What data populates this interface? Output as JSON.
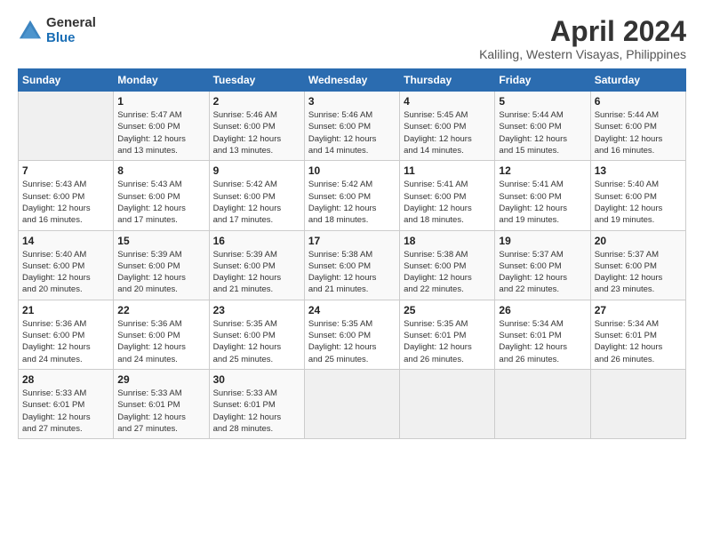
{
  "logo": {
    "general": "General",
    "blue": "Blue"
  },
  "title": "April 2024",
  "subtitle": "Kaliling, Western Visayas, Philippines",
  "days_header": [
    "Sunday",
    "Monday",
    "Tuesday",
    "Wednesday",
    "Thursday",
    "Friday",
    "Saturday"
  ],
  "weeks": [
    [
      {
        "num": "",
        "info": ""
      },
      {
        "num": "1",
        "info": "Sunrise: 5:47 AM\nSunset: 6:00 PM\nDaylight: 12 hours\nand 13 minutes."
      },
      {
        "num": "2",
        "info": "Sunrise: 5:46 AM\nSunset: 6:00 PM\nDaylight: 12 hours\nand 13 minutes."
      },
      {
        "num": "3",
        "info": "Sunrise: 5:46 AM\nSunset: 6:00 PM\nDaylight: 12 hours\nand 14 minutes."
      },
      {
        "num": "4",
        "info": "Sunrise: 5:45 AM\nSunset: 6:00 PM\nDaylight: 12 hours\nand 14 minutes."
      },
      {
        "num": "5",
        "info": "Sunrise: 5:44 AM\nSunset: 6:00 PM\nDaylight: 12 hours\nand 15 minutes."
      },
      {
        "num": "6",
        "info": "Sunrise: 5:44 AM\nSunset: 6:00 PM\nDaylight: 12 hours\nand 16 minutes."
      }
    ],
    [
      {
        "num": "7",
        "info": "Sunrise: 5:43 AM\nSunset: 6:00 PM\nDaylight: 12 hours\nand 16 minutes."
      },
      {
        "num": "8",
        "info": "Sunrise: 5:43 AM\nSunset: 6:00 PM\nDaylight: 12 hours\nand 17 minutes."
      },
      {
        "num": "9",
        "info": "Sunrise: 5:42 AM\nSunset: 6:00 PM\nDaylight: 12 hours\nand 17 minutes."
      },
      {
        "num": "10",
        "info": "Sunrise: 5:42 AM\nSunset: 6:00 PM\nDaylight: 12 hours\nand 18 minutes."
      },
      {
        "num": "11",
        "info": "Sunrise: 5:41 AM\nSunset: 6:00 PM\nDaylight: 12 hours\nand 18 minutes."
      },
      {
        "num": "12",
        "info": "Sunrise: 5:41 AM\nSunset: 6:00 PM\nDaylight: 12 hours\nand 19 minutes."
      },
      {
        "num": "13",
        "info": "Sunrise: 5:40 AM\nSunset: 6:00 PM\nDaylight: 12 hours\nand 19 minutes."
      }
    ],
    [
      {
        "num": "14",
        "info": "Sunrise: 5:40 AM\nSunset: 6:00 PM\nDaylight: 12 hours\nand 20 minutes."
      },
      {
        "num": "15",
        "info": "Sunrise: 5:39 AM\nSunset: 6:00 PM\nDaylight: 12 hours\nand 20 minutes."
      },
      {
        "num": "16",
        "info": "Sunrise: 5:39 AM\nSunset: 6:00 PM\nDaylight: 12 hours\nand 21 minutes."
      },
      {
        "num": "17",
        "info": "Sunrise: 5:38 AM\nSunset: 6:00 PM\nDaylight: 12 hours\nand 21 minutes."
      },
      {
        "num": "18",
        "info": "Sunrise: 5:38 AM\nSunset: 6:00 PM\nDaylight: 12 hours\nand 22 minutes."
      },
      {
        "num": "19",
        "info": "Sunrise: 5:37 AM\nSunset: 6:00 PM\nDaylight: 12 hours\nand 22 minutes."
      },
      {
        "num": "20",
        "info": "Sunrise: 5:37 AM\nSunset: 6:00 PM\nDaylight: 12 hours\nand 23 minutes."
      }
    ],
    [
      {
        "num": "21",
        "info": "Sunrise: 5:36 AM\nSunset: 6:00 PM\nDaylight: 12 hours\nand 24 minutes."
      },
      {
        "num": "22",
        "info": "Sunrise: 5:36 AM\nSunset: 6:00 PM\nDaylight: 12 hours\nand 24 minutes."
      },
      {
        "num": "23",
        "info": "Sunrise: 5:35 AM\nSunset: 6:00 PM\nDaylight: 12 hours\nand 25 minutes."
      },
      {
        "num": "24",
        "info": "Sunrise: 5:35 AM\nSunset: 6:00 PM\nDaylight: 12 hours\nand 25 minutes."
      },
      {
        "num": "25",
        "info": "Sunrise: 5:35 AM\nSunset: 6:01 PM\nDaylight: 12 hours\nand 26 minutes."
      },
      {
        "num": "26",
        "info": "Sunrise: 5:34 AM\nSunset: 6:01 PM\nDaylight: 12 hours\nand 26 minutes."
      },
      {
        "num": "27",
        "info": "Sunrise: 5:34 AM\nSunset: 6:01 PM\nDaylight: 12 hours\nand 26 minutes."
      }
    ],
    [
      {
        "num": "28",
        "info": "Sunrise: 5:33 AM\nSunset: 6:01 PM\nDaylight: 12 hours\nand 27 minutes."
      },
      {
        "num": "29",
        "info": "Sunrise: 5:33 AM\nSunset: 6:01 PM\nDaylight: 12 hours\nand 27 minutes."
      },
      {
        "num": "30",
        "info": "Sunrise: 5:33 AM\nSunset: 6:01 PM\nDaylight: 12 hours\nand 28 minutes."
      },
      {
        "num": "",
        "info": ""
      },
      {
        "num": "",
        "info": ""
      },
      {
        "num": "",
        "info": ""
      },
      {
        "num": "",
        "info": ""
      }
    ]
  ]
}
